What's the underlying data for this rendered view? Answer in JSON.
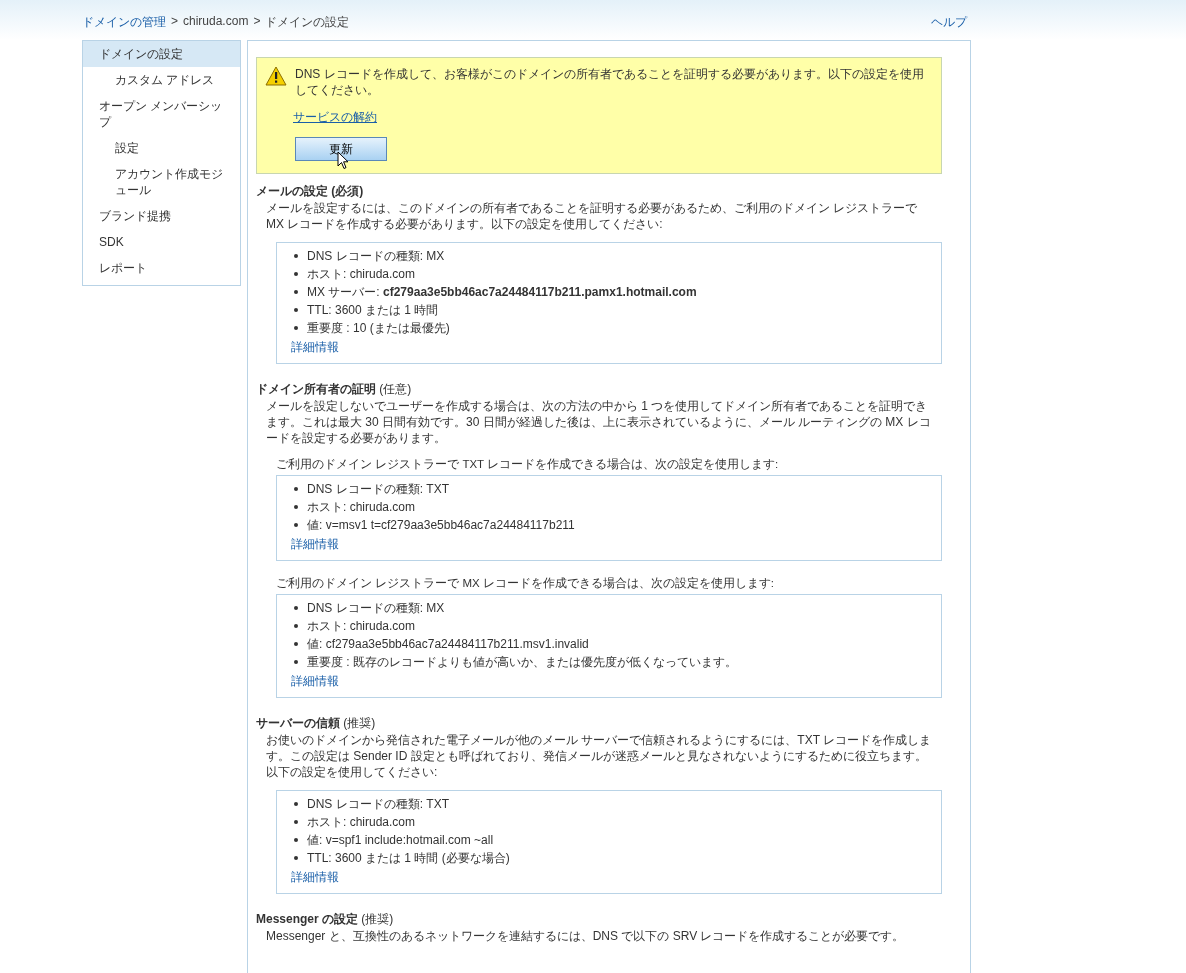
{
  "breadcrumb": {
    "items": [
      {
        "label": "ドメインの管理",
        "link": true
      },
      {
        "label": "chiruda.com",
        "link": false
      },
      {
        "label": "ドメインの設定",
        "link": false
      }
    ],
    "separator": ">",
    "help": "ヘルプ"
  },
  "sidebar": {
    "items": [
      {
        "label": "ドメインの設定",
        "selected": true,
        "children": [
          {
            "label": "カスタム アドレス",
            "selected": false
          }
        ]
      },
      {
        "label": "オープン メンバーシップ",
        "selected": false,
        "children": [
          {
            "label": "設定",
            "selected": false
          },
          {
            "label": "アカウント作成モジュール",
            "selected": false
          }
        ]
      },
      {
        "label": "ブランド提携",
        "selected": false
      },
      {
        "label": "SDK",
        "selected": false
      },
      {
        "label": "レポート",
        "selected": false
      }
    ]
  },
  "alert": {
    "message": "DNS レコードを作成して、お客様がこのドメインの所有者であることを証明する必要があります。以下の設定を使用してください。",
    "link": "サービスの解約",
    "button": "更新"
  },
  "sections": [
    {
      "title": "**メールの設定 (必須)**",
      "description": "メールを設定するには、このドメインの所有者であることを証明する必要があるため、ご利用のドメイン レジストラーで MX レコードを作成する必要があります。以下の設定を使用してください:",
      "blocks": [
        {
          "items": [
            "DNS レコードの種類: MX",
            "ホスト: chiruda.com",
            "MX サーバー: **cf279aa3e5bb46ac7a24484117b211.pamx1.hotmail.com**",
            "TTL: 3600 または 1 時間",
            "重要度 : 10 (または最優先)"
          ],
          "link": "詳細情報"
        }
      ]
    },
    {
      "title": "**ドメイン所有者の証明** (任意)",
      "description": "メールを設定しないでユーザーを作成する場合は、次の方法の中から 1 つを使用してドメイン所有者であることを証明できます。これは最大 30 日間有効です。30 日間が経過した後は、上に表示されているように、メール ルーティングの MX レコードを設定する必要があります。",
      "blocks": [
        {
          "intro": "ご利用のドメイン レジストラーで TXT レコードを作成できる場合は、次の設定を使用します:",
          "items": [
            "DNS レコードの種類: TXT",
            "ホスト: chiruda.com",
            "値: v=msv1 t=cf279aa3e5bb46ac7a24484117b211"
          ],
          "link": "詳細情報"
        },
        {
          "intro": "ご利用のドメイン レジストラーで MX レコードを作成できる場合は、次の設定を使用します:",
          "items": [
            "DNS レコードの種類: MX",
            "ホスト: chiruda.com",
            "値: cf279aa3e5bb46ac7a24484117b211.msv1.invalid",
            "重要度 : 既存のレコードよりも値が高いか、または優先度が低くなっています。"
          ],
          "link": "詳細情報"
        }
      ]
    },
    {
      "title": "**サーバーの信頼** (推奨)",
      "description": "お使いのドメインから発信された電子メールが他のメール サーバーで信頼されるようにするには、TXT レコードを作成します。この設定は Sender ID 設定とも呼ばれており、発信メールが迷惑メールと見なされないようにするために役立ちます。以下の設定を使用してください:",
      "blocks": [
        {
          "items": [
            "DNS レコードの種類: TXT",
            "ホスト: chiruda.com",
            "値: v=spf1 include:hotmail.com ~all",
            "TTL: 3600 または 1 時間 (必要な場合)"
          ],
          "link": "詳細情報"
        }
      ]
    },
    {
      "title": "**Messenger の設定** (推奨)",
      "description": "Messenger と、互換性のあるネットワークを連結するには、DNS で以下の SRV レコードを作成することが必要です。"
    }
  ]
}
